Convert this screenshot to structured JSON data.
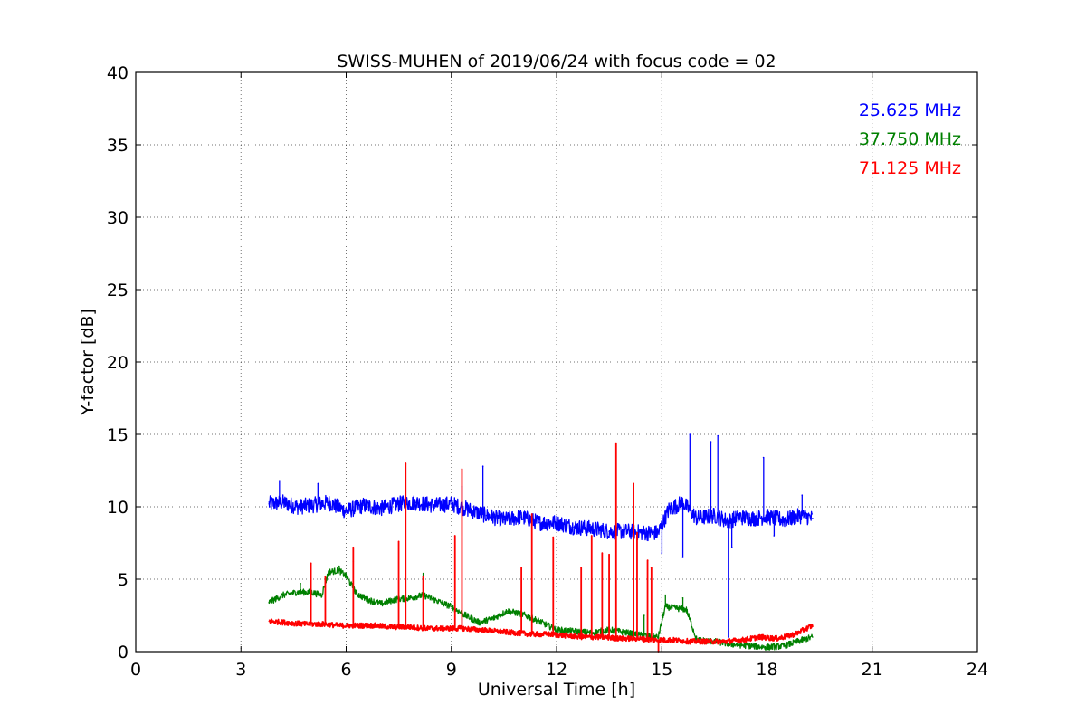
{
  "chart_data": {
    "type": "line",
    "title": "SWISS-MUHEN of 2019/06/24 with focus code = 02",
    "xlabel": "Universal Time [h]",
    "ylabel": "Y-factor [dB]",
    "xlim": [
      0,
      24
    ],
    "ylim": [
      0,
      40
    ],
    "xticks": [
      "0",
      "3",
      "6",
      "9",
      "12",
      "15",
      "18",
      "21",
      "24"
    ],
    "yticks": [
      "0",
      "5",
      "10",
      "15",
      "20",
      "25",
      "30",
      "35",
      "40"
    ],
    "grid": true,
    "legend_position": "top-right",
    "series": [
      {
        "name": "25.625 MHz",
        "color": "#0000ff",
        "x": [
          3.8,
          4.2,
          4.6,
          5.0,
          5.5,
          6.0,
          6.5,
          7.0,
          7.5,
          8.0,
          8.5,
          9.0,
          9.5,
          10.0,
          10.5,
          11.0,
          11.5,
          12.0,
          12.5,
          13.0,
          13.5,
          14.0,
          14.5,
          14.9,
          15.2,
          15.6,
          16.0,
          16.5,
          16.9,
          17.2,
          17.6,
          18.0,
          18.5,
          19.0,
          19.3
        ],
        "y": [
          10.2,
          10.3,
          10.0,
          10.1,
          10.3,
          9.7,
          10.1,
          9.9,
          10.2,
          10.3,
          10.1,
          10.2,
          9.8,
          9.4,
          9.1,
          9.3,
          8.9,
          8.9,
          8.6,
          8.5,
          8.3,
          8.3,
          8.2,
          8.2,
          9.8,
          10.3,
          9.2,
          9.4,
          9.0,
          9.3,
          9.2,
          9.3,
          9.1,
          9.4,
          9.2
        ],
        "spikes": [
          [
            4.1,
            11.8
          ],
          [
            5.2,
            11.6
          ],
          [
            7.7,
            11.8
          ],
          [
            9.3,
            11.4
          ],
          [
            9.9,
            12.8
          ],
          [
            14.2,
            11.0
          ],
          [
            15.0,
            6.8
          ],
          [
            15.6,
            6.5
          ],
          [
            15.8,
            15.0
          ],
          [
            16.4,
            14.5
          ],
          [
            16.6,
            14.9
          ],
          [
            16.9,
            1.0
          ],
          [
            17.0,
            7.2
          ],
          [
            17.9,
            13.4
          ],
          [
            18.2,
            8.0
          ],
          [
            19.0,
            10.8
          ]
        ]
      },
      {
        "name": "37.750 MHz",
        "color": "#008000",
        "x": [
          3.8,
          4.2,
          4.6,
          5.0,
          5.3,
          5.5,
          5.8,
          6.0,
          6.3,
          6.6,
          7.0,
          7.4,
          7.8,
          8.2,
          8.6,
          9.0,
          9.4,
          9.8,
          10.2,
          10.6,
          11.0,
          11.5,
          12.0,
          12.5,
          13.0,
          13.5,
          14.0,
          14.5,
          14.9,
          15.1,
          15.4,
          15.7,
          16.0,
          16.5,
          17.0,
          17.5,
          18.0,
          18.5,
          19.0,
          19.3
        ],
        "y": [
          3.4,
          3.9,
          4.1,
          4.1,
          3.9,
          5.5,
          5.6,
          5.2,
          4.0,
          3.6,
          3.3,
          3.6,
          3.7,
          3.9,
          3.5,
          3.1,
          2.5,
          2.0,
          2.3,
          2.8,
          2.6,
          2.1,
          1.5,
          1.4,
          1.3,
          1.5,
          1.3,
          1.1,
          1.0,
          3.1,
          3.0,
          2.9,
          0.8,
          0.7,
          0.5,
          0.4,
          0.3,
          0.4,
          0.8,
          1.0
        ],
        "spikes": [
          [
            4.7,
            4.7
          ],
          [
            5.8,
            5.9
          ],
          [
            6.2,
            6.2
          ],
          [
            8.2,
            5.4
          ],
          [
            11.0,
            3.0
          ],
          [
            14.5,
            2.5
          ],
          [
            15.1,
            3.9
          ],
          [
            15.6,
            3.7
          ]
        ]
      },
      {
        "name": "71.125 MHz",
        "color": "#ff0000",
        "x": [
          3.8,
          4.3,
          4.8,
          5.3,
          5.8,
          6.3,
          6.8,
          7.3,
          7.8,
          8.3,
          8.8,
          9.3,
          9.8,
          10.3,
          10.8,
          11.3,
          11.8,
          12.3,
          12.8,
          13.3,
          13.8,
          14.3,
          14.8,
          15.3,
          15.8,
          16.3,
          16.8,
          17.3,
          17.8,
          18.3,
          18.8,
          19.3
        ],
        "y": [
          2.1,
          2.0,
          1.9,
          1.9,
          1.8,
          1.8,
          1.8,
          1.7,
          1.7,
          1.6,
          1.6,
          1.6,
          1.5,
          1.4,
          1.3,
          1.2,
          1.2,
          1.1,
          1.0,
          1.0,
          0.9,
          0.9,
          0.8,
          0.8,
          0.7,
          0.7,
          0.7,
          0.8,
          1.0,
          0.9,
          1.2,
          1.8
        ],
        "spikes": [
          [
            5.0,
            6.1
          ],
          [
            5.4,
            5.2
          ],
          [
            6.2,
            7.2
          ],
          [
            7.5,
            7.6
          ],
          [
            7.7,
            13.0
          ],
          [
            8.2,
            5.2
          ],
          [
            9.1,
            8.0
          ],
          [
            9.3,
            12.6
          ],
          [
            11.0,
            5.8
          ],
          [
            11.3,
            9.5
          ],
          [
            11.9,
            7.9
          ],
          [
            12.7,
            5.8
          ],
          [
            13.0,
            8.0
          ],
          [
            13.3,
            6.8
          ],
          [
            13.5,
            6.7
          ],
          [
            13.7,
            14.4
          ],
          [
            14.2,
            11.6
          ],
          [
            14.3,
            8.2
          ],
          [
            14.6,
            6.3
          ],
          [
            14.7,
            5.8
          ],
          [
            14.9,
            0.0
          ]
        ]
      }
    ]
  }
}
